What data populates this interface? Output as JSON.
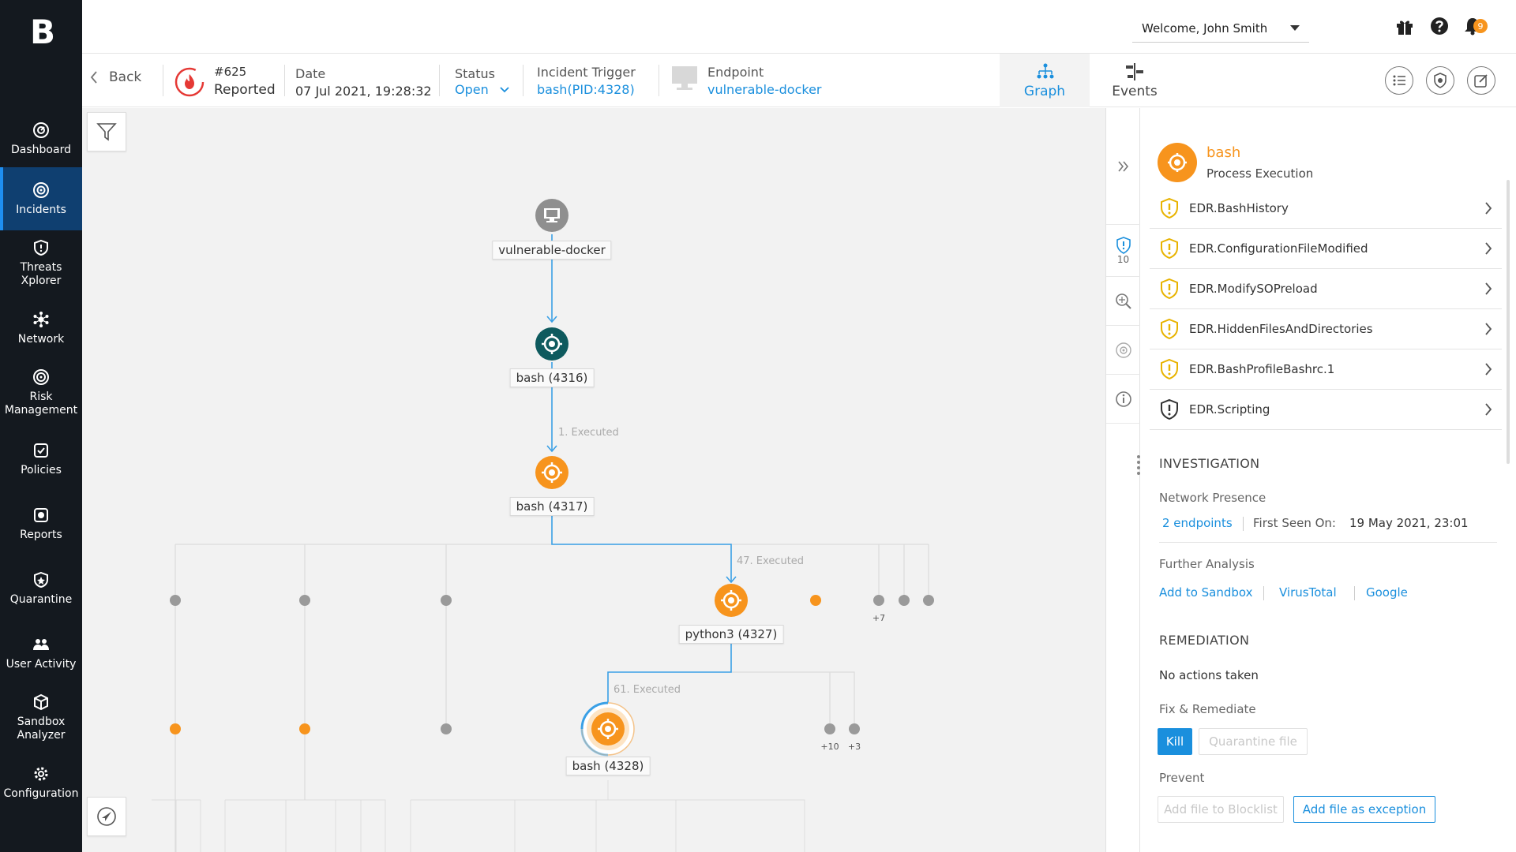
{
  "app": {
    "logo": "B"
  },
  "sidebar": {
    "items": [
      {
        "label": "Dashboard",
        "icon": "dashboard-icon"
      },
      {
        "label": "Incidents",
        "icon": "incidents-icon",
        "active": true
      },
      {
        "label": "Threats\nXplorer",
        "icon": "threats-icon"
      },
      {
        "label": "Network",
        "icon": "network-icon"
      },
      {
        "label": "Risk\nManagement",
        "icon": "risk-icon"
      },
      {
        "label": "Policies",
        "icon": "policies-icon"
      },
      {
        "label": "Reports",
        "icon": "reports-icon"
      },
      {
        "label": "Quarantine",
        "icon": "quarantine-icon"
      },
      {
        "label": "User Activity",
        "icon": "user-activity-icon"
      },
      {
        "label": "Sandbox\nAnalyzer",
        "icon": "sandbox-icon"
      },
      {
        "label": "Configuration",
        "icon": "configuration-icon"
      }
    ]
  },
  "topbar": {
    "welcome": "Welcome, John Smith",
    "notification_count": "9",
    "icons": [
      "gift-icon",
      "help-icon",
      "bell-icon"
    ]
  },
  "incident": {
    "back_label": "Back",
    "number": "#625",
    "state": "Reported",
    "date_label": "Date",
    "date_value": "07 Jul 2021, 19:28:32",
    "status_label": "Status",
    "status_value": "Open",
    "trigger_label": "Incident Trigger",
    "trigger_value": "bash(PID:4328)",
    "endpoint_label": "Endpoint",
    "endpoint_value": "vulnerable-docker",
    "tabs": {
      "graph": "Graph",
      "events": "Events"
    }
  },
  "graph": {
    "nodes": {
      "endpoint": "vulnerable-docker",
      "bash1": "bash (4316)",
      "bash2": "bash (4317)",
      "python": "python3 (4327)",
      "bash3": "bash (4328)"
    },
    "edges": {
      "e1": "1. Executed",
      "e2": "47. Executed",
      "e3": "61. Executed"
    },
    "more": {
      "m1": "+7",
      "m2": "+10",
      "m3": "+3"
    },
    "colors": {
      "orange": "#f7941d",
      "teal": "#0e5a5e",
      "gray": "#9a9a9a",
      "edge": "#3aa0e6"
    }
  },
  "side_strip": {
    "alert_count": "10"
  },
  "panel": {
    "process_name": "bash",
    "process_type": "Process Execution",
    "rules": [
      {
        "name": "EDR.BashHistory",
        "color": "#e8b300"
      },
      {
        "name": "EDR.ConfigurationFileModified",
        "color": "#e8b300"
      },
      {
        "name": "EDR.ModifySOPreload",
        "color": "#e8b300"
      },
      {
        "name": "EDR.HiddenFilesAndDirectories",
        "color": "#e8b300"
      },
      {
        "name": "EDR.BashProfileBashrc.1",
        "color": "#e8b300"
      },
      {
        "name": "EDR.Scripting",
        "color": "#333333"
      }
    ],
    "investigation_title": "INVESTIGATION",
    "network_presence_label": "Network Presence",
    "endpoints_link": "2 endpoints",
    "first_seen_label": "First Seen On:",
    "first_seen_value": "19 May 2021, 23:01",
    "further_analysis_label": "Further Analysis",
    "links": [
      "Add to Sandbox",
      "VirusTotal",
      "Google"
    ],
    "remediation_title": "REMEDIATION",
    "no_actions": "No actions taken",
    "fix_label": "Fix & Remediate",
    "kill_label": "Kill",
    "quarantine_label": "Quarantine file",
    "prevent_label": "Prevent",
    "blocklist_label": "Add file to Blocklist",
    "exception_label": "Add file as exception"
  }
}
